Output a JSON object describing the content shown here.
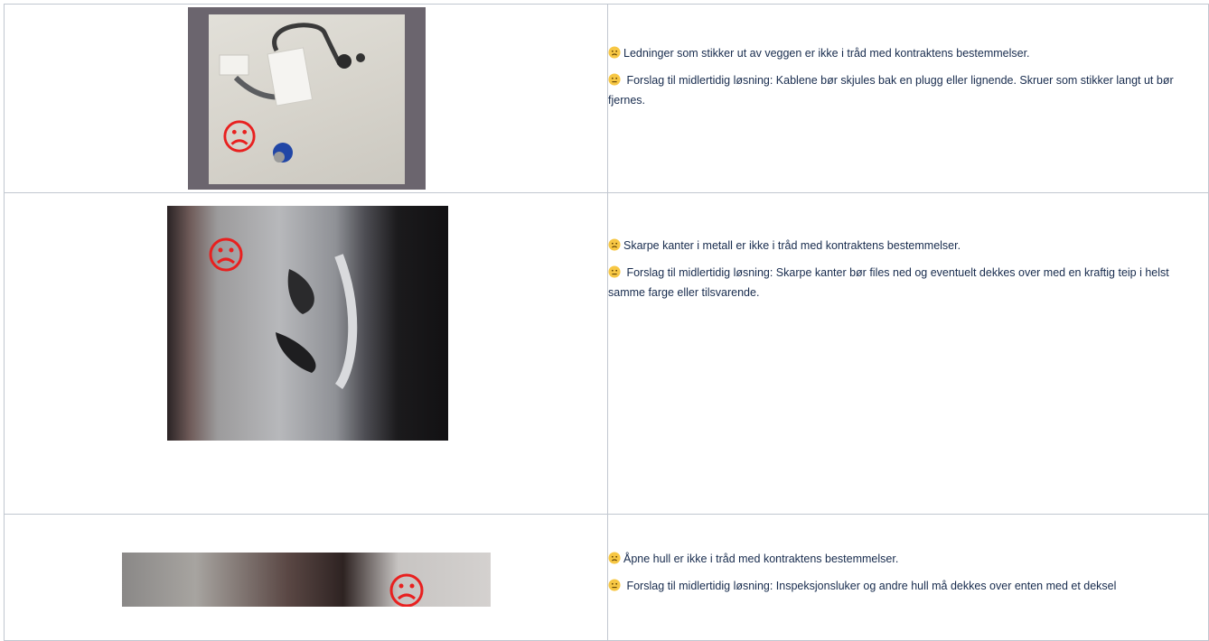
{
  "rows": [
    {
      "issue": "Ledninger som stikker ut av veggen er ikke i tråd med kontraktens bestemmelser.",
      "suggestion": " Forslag til midlertidig løsning: Kablene bør skjules bak en plugg eller lignende. Skruer som stikker langt ut bør fjernes."
    },
    {
      "issue": "Skarpe kanter i metall er ikke i tråd med kontraktens bestemmelser.",
      "suggestion": " Forslag til midlertidig løsning: Skarpe kanter bør files ned og eventuelt dekkes over med en kraftig teip i helst samme farge eller tilsvarende."
    },
    {
      "issue": "Åpne hull er ikke i tråd med kontraktens bestemmelser.",
      "suggestion": " Forslag til midlertidig løsning: Inspeksjonsluker og andre hull må dekkes over enten med et deksel"
    }
  ],
  "icons": {
    "issue_icon": "frowning-face-emoji",
    "suggestion_icon": "neutral-face-emoji",
    "photo_marker": "sad-face-marker"
  },
  "colors": {
    "border": "#c1c7d0",
    "text": "#172b4d",
    "emoji_fill": "#f7c744",
    "marker_red": "#e8201f"
  }
}
